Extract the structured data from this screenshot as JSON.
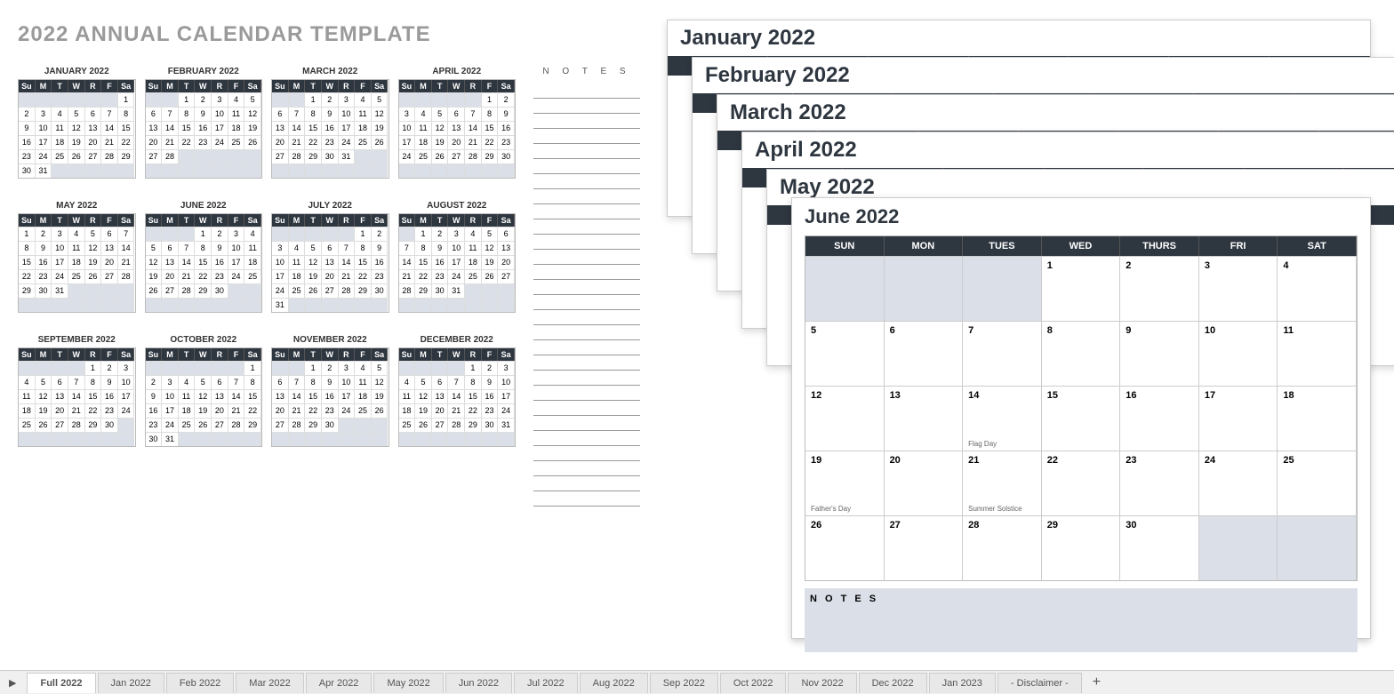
{
  "title": "2022 ANNUAL CALENDAR TEMPLATE",
  "notes_label": "N O T E S",
  "days_short": [
    "Su",
    "M",
    "T",
    "W",
    "R",
    "F",
    "Sa"
  ],
  "days_long": [
    "SUN",
    "MON",
    "TUES",
    "WED",
    "THURS",
    "FRI",
    "SAT"
  ],
  "months": [
    {
      "name": "JANUARY 2022",
      "start": 6,
      "len": 31
    },
    {
      "name": "FEBRUARY 2022",
      "start": 2,
      "len": 28
    },
    {
      "name": "MARCH 2022",
      "start": 2,
      "len": 31
    },
    {
      "name": "APRIL 2022",
      "start": 5,
      "len": 30
    },
    {
      "name": "MAY 2022",
      "start": 0,
      "len": 31
    },
    {
      "name": "JUNE 2022",
      "start": 3,
      "len": 30
    },
    {
      "name": "JULY 2022",
      "start": 5,
      "len": 31
    },
    {
      "name": "AUGUST 2022",
      "start": 1,
      "len": 31
    },
    {
      "name": "SEPTEMBER 2022",
      "start": 4,
      "len": 30
    },
    {
      "name": "OCTOBER 2022",
      "start": 6,
      "len": 31
    },
    {
      "name": "NOVEMBER 2022",
      "start": 2,
      "len": 30
    },
    {
      "name": "DECEMBER 2022",
      "start": 4,
      "len": 31
    }
  ],
  "stack": [
    "January 2022",
    "February 2022",
    "March 2022",
    "April 2022",
    "May 2022",
    "June 2022"
  ],
  "june": {
    "title": "June 2022",
    "start": 3,
    "len": 30,
    "events": {
      "14": "Flag Day",
      "19": "Father's Day",
      "21": "Summer Solstice"
    },
    "notes": "N O T E S"
  },
  "tabs": [
    "Full 2022",
    "Jan 2022",
    "Feb 2022",
    "Mar 2022",
    "Apr 2022",
    "May 2022",
    "Jun 2022",
    "Jul 2022",
    "Aug 2022",
    "Sep 2022",
    "Oct 2022",
    "Nov 2022",
    "Dec 2022",
    "Jan 2023",
    "- Disclaimer -"
  ],
  "active_tab": "Full 2022"
}
